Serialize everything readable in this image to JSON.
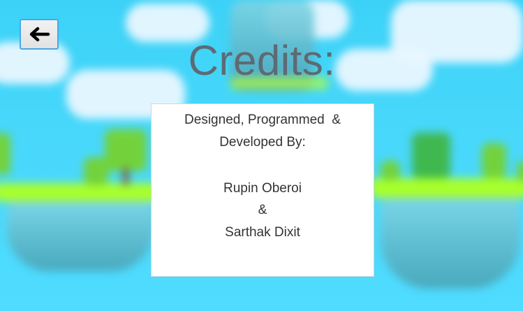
{
  "screen": {
    "title": "Credits:"
  },
  "back_button": {
    "icon": "arrow-left-icon",
    "glyph": "←"
  },
  "credits": {
    "heading_line1": "Designed, Programmed  &",
    "heading_line2": "Developed By:",
    "name1": "Rupin Oberoi",
    "separator": "&",
    "name2": "Sarthak Dixit"
  },
  "colors": {
    "sky": "#3cd2f7",
    "title_text": "#5e6a73",
    "button_border": "#4fa6e3",
    "island_grass": "#a8ff2c"
  }
}
